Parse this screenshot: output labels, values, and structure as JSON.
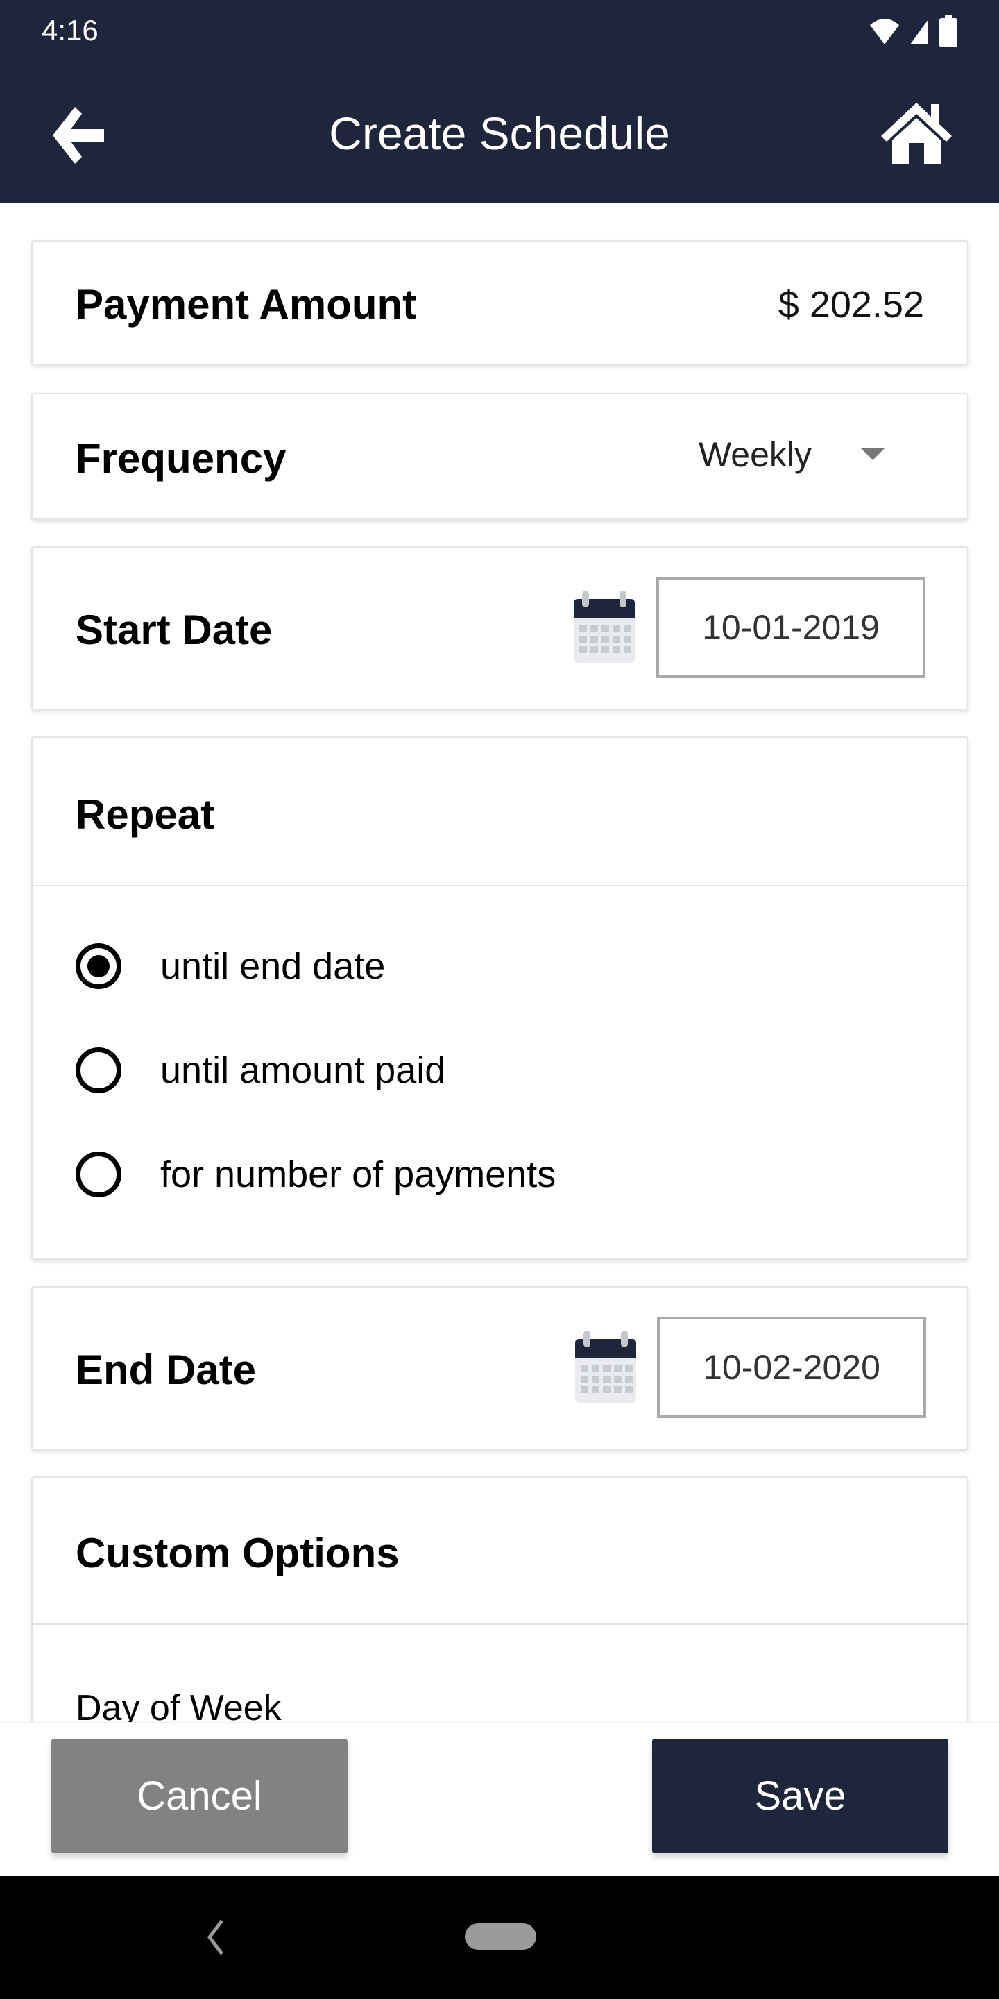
{
  "status_bar": {
    "time": "4:16",
    "icons": [
      "wifi-icon",
      "cell-signal-icon",
      "battery-icon"
    ]
  },
  "app_bar": {
    "title": "Create Schedule",
    "back_icon": "arrow-left-icon",
    "home_icon": "home-icon"
  },
  "form": {
    "payment_amount": {
      "label": "Payment Amount",
      "value": "$ 202.52"
    },
    "frequency": {
      "label": "Frequency",
      "selected": "Weekly"
    },
    "start_date": {
      "label": "Start Date",
      "value": "10-01-2019"
    },
    "repeat": {
      "label": "Repeat",
      "options": [
        {
          "label": "until end date",
          "selected": true
        },
        {
          "label": "until amount paid",
          "selected": false
        },
        {
          "label": "for number of payments",
          "selected": false
        }
      ]
    },
    "end_date": {
      "label": "End Date",
      "value": "10-02-2020"
    },
    "custom_options": {
      "label": "Custom Options",
      "day_of_week_label": "Day of Week"
    }
  },
  "footer": {
    "cancel_label": "Cancel",
    "save_label": "Save"
  },
  "colors": {
    "primary": "#1f263b",
    "cancel": "#828282"
  }
}
